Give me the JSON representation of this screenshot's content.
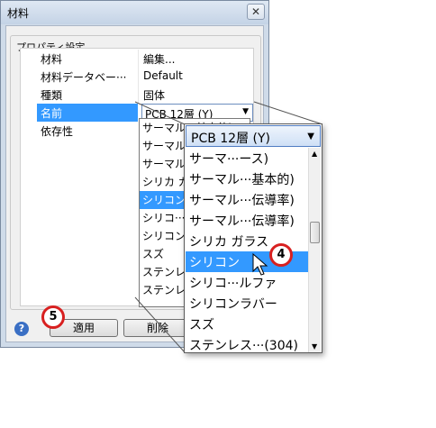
{
  "window": {
    "title": "材料",
    "close_glyph": "✕"
  },
  "group": {
    "legend": "プロパティ設定"
  },
  "properties": [
    {
      "key": "材料",
      "value": "編集..."
    },
    {
      "key": "材料データベー···",
      "value": "Default"
    },
    {
      "key": "種類",
      "value": "固体"
    },
    {
      "key": "名前",
      "value": "PCB 12層 (Y)"
    },
    {
      "key": "依存性",
      "value": ""
    }
  ],
  "small_list": {
    "items": [
      "サーマル···基本的)",
      "サーマル···",
      "サーマル···",
      "シリカ ガラス",
      "シリコン",
      "シリコ···",
      "シリコン···",
      "スズ",
      "ステンレ···",
      "ステンレ···"
    ],
    "selected_index": 4
  },
  "zoom_dropdown": {
    "combo_value": "PCB 12層 (Y)",
    "items": [
      "サーマ···ース)",
      "サーマル···基本的)",
      "サーマル···伝導率)",
      "サーマル···伝導率)",
      "シリカ ガラス",
      "シリコン",
      "シリコ···ルファ",
      "シリコンラバー",
      "スズ",
      "ステンレス···(304)"
    ],
    "selected_index": 5
  },
  "buttons": {
    "apply": "適用",
    "delete": "削除",
    "help": "?"
  },
  "callouts": {
    "step4": "4",
    "step5": "5"
  },
  "icons": {
    "dropdown": "▼",
    "scroll_up": "▲",
    "scroll_down": "▼"
  },
  "colors": {
    "selection": "#3399ff",
    "callout_border": "#d82020"
  }
}
